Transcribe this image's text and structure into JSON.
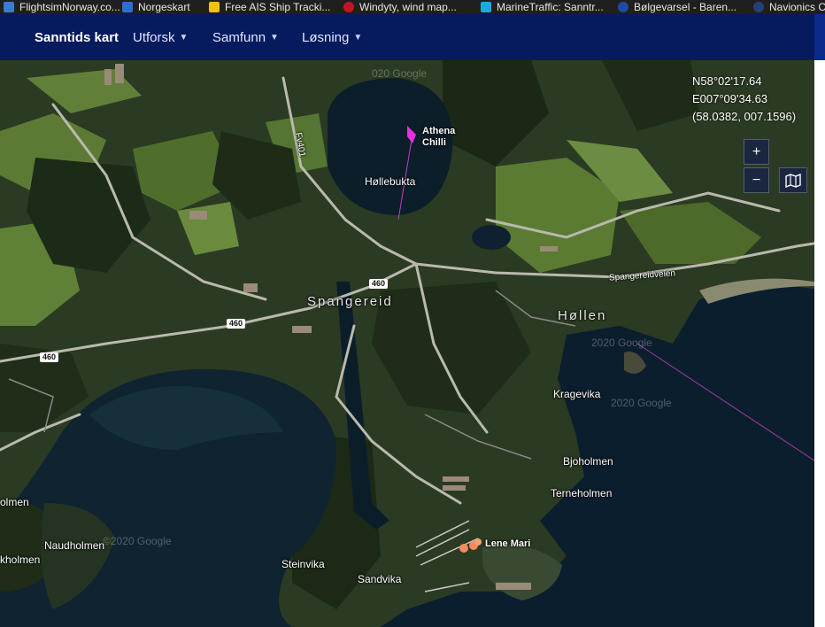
{
  "bookmarks": [
    {
      "label": "FlightsimNorway.co...",
      "icon": "flight-site-icon",
      "color": "#3a7bd5"
    },
    {
      "label": "Norgeskart",
      "icon": "norgeskart-icon",
      "color": "#2d6cdf"
    },
    {
      "label": "Free AIS Ship Tracki...",
      "icon": "ais-tracker-icon",
      "color": "#f2c200"
    },
    {
      "label": "Windyty, wind map...",
      "icon": "windy-icon",
      "color": "#c0142b"
    },
    {
      "label": "MarineTraffic: Sanntr...",
      "icon": "marinetraffic-icon",
      "color": "#1ea7e8"
    },
    {
      "label": "Bølgevarsel - Baren...",
      "icon": "wave-forecast-icon",
      "color": "#1e4aa8"
    },
    {
      "label": "Navionics C",
      "icon": "navionics-icon",
      "color": "#23407a"
    }
  ],
  "nav": {
    "brand": "Sanntids kart",
    "menus": [
      {
        "label": "Utforsk"
      },
      {
        "label": "Samfunn"
      },
      {
        "label": "Løsning"
      }
    ]
  },
  "coords": {
    "lat": "N58°02'17.64",
    "lon": "E007°09'34.63",
    "decimal": "(58.0382, 007.1596)"
  },
  "controls": {
    "zoom_in": "+",
    "zoom_out": "−"
  },
  "map": {
    "places": {
      "hollebukta": "Høllebukta",
      "spangereid": "Spangereid",
      "hollen": "Høllen",
      "kragevika": "Kragevika",
      "bjoholmen": "Bjoholmen",
      "terneholmen": "Terneholmen",
      "naudholmen": "Naudholmen",
      "steinvika": "Steinvika",
      "sandvika": "Sandvika",
      "olmen_left": "olmen",
      "kholmen_left": "kholmen",
      "road_spangereidveien": "Spangereidveien",
      "road_fv401": "Fv401"
    },
    "shields": [
      "460",
      "460",
      "460"
    ],
    "ships": {
      "athena_line1": "Athena",
      "athena_line2": "Chilli",
      "lene_mari": "Lene Mari"
    },
    "watermarks": [
      "020 Google",
      "©2020 Google",
      "2020 Google",
      "2020 Google"
    ]
  },
  "colors": {
    "nav_bg": "#061a5e",
    "ship_marker": "#e62ee6",
    "ship_marker_2": "#f28c5a",
    "sea": "#0b1e2e"
  }
}
